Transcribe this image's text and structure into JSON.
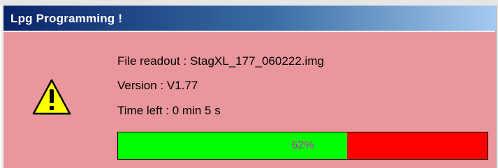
{
  "window": {
    "title": "Lpg Programming !"
  },
  "dialog": {
    "icon": "warning-icon",
    "file_readout": "File readout : StagXL_177_060222.img",
    "version": "Version : V1.77",
    "time_left": "Time left : 0 min 5 s"
  },
  "progress": {
    "value": 0.62,
    "label": "62%"
  },
  "colors": {
    "panel_background": "#e9969c",
    "progress_done": "#00ff00",
    "progress_remaining": "#ff0000",
    "progress_label": "#d020c0",
    "title_gradient_start": "#0a246a",
    "title_gradient_end": "#a6caf0"
  }
}
